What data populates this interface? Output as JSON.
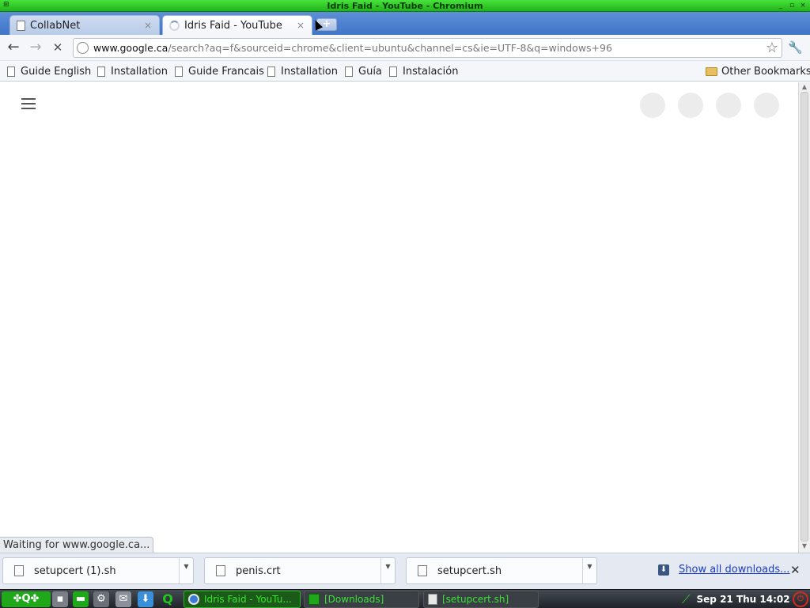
{
  "window": {
    "title": "Idris Faid - YouTube - Chromium",
    "controls": [
      "_",
      "▫",
      "×"
    ]
  },
  "tabs": [
    {
      "label": "CollabNet",
      "active": false
    },
    {
      "label": "Idris Faid - YouTube",
      "active": true,
      "loading": true
    }
  ],
  "toolbar": {
    "url_host": "www.google.ca",
    "url_rest": "/search?aq=f&sourceid=chrome&client=ubuntu&channel=cs&ie=UTF-8&q=windows+96"
  },
  "bookmarks": [
    {
      "label": "Guide English"
    },
    {
      "label": "Installation"
    },
    {
      "label": "Guide Francais"
    },
    {
      "label": "Installation"
    },
    {
      "label": "Guía"
    },
    {
      "label": "Instalación"
    }
  ],
  "other_bookmarks": "Other Bookmarks",
  "status": "Waiting for www.google.ca...",
  "downloads": [
    {
      "name": "setupcert (1).sh"
    },
    {
      "name": "penis.crt"
    },
    {
      "name": "setupcert.sh"
    }
  ],
  "show_all_downloads": "Show all downloads...",
  "taskbar": {
    "tasks": [
      {
        "label": "Idris Faid - YouTu..."
      },
      {
        "label": "[Downloads]"
      },
      {
        "label": "[setupcert.sh]"
      }
    ],
    "clock": "Sep 21 Thu 14:02"
  },
  "colors": {
    "titlebar": "#22b31a",
    "tabstrip": "#3f75c8",
    "link": "#1a3cc7",
    "taskbar_text": "#39e431"
  }
}
